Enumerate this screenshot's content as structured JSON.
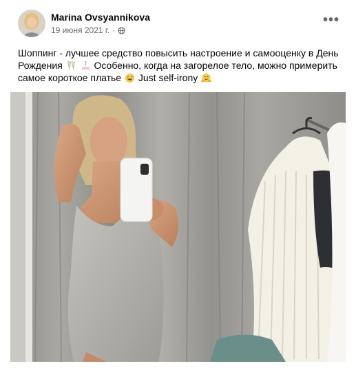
{
  "post": {
    "author": "Marina Ovsyannikova",
    "date": "19 июня 2021 г.",
    "separator": "·",
    "privacy_icon": "globe-icon",
    "more_icon": "more-options-icon",
    "text_part1": "Шоппинг - лучшее средство повысить настроение и самооценку в День Рождения",
    "text_part2": " Особенно, когда на загорелое тело, можно примерить самое короткое платье",
    "text_part3": " Just self-irony",
    "emojis": [
      "clinking-glasses-emoji",
      "birthday-cake-emoji",
      "grinning-sweat-emoji",
      "hugging-face-emoji"
    ]
  },
  "colors": {
    "author": "#050505",
    "meta": "#65676b",
    "background": "#ffffff"
  }
}
